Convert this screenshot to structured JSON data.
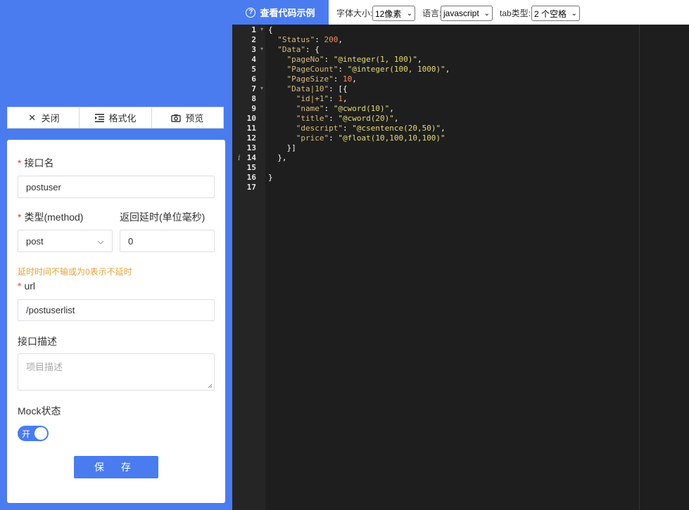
{
  "toolbar": {
    "close": "关闭",
    "format": "格式化",
    "preview": "预览"
  },
  "form": {
    "name_label": "接口名",
    "name_value": "postuser",
    "method_label": "类型(method)",
    "method_value": "post",
    "delay_label": "返回延时(单位毫秒)",
    "delay_value": "0",
    "delay_hint": "延时时间不输或为0表示不延时",
    "url_label": "url",
    "url_value": "/postuserlist",
    "desc_label": "接口描述",
    "desc_placeholder": "项目描述",
    "mock_label": "Mock状态",
    "mock_on": "开",
    "save": "保 存"
  },
  "topbar": {
    "help": "查看代码示例",
    "font_size_label": "字体大小:",
    "font_size_value": "12像素",
    "lang_label": "语言:",
    "lang_value": "javascript",
    "tab_label": "tab类型:",
    "tab_value": "2 个空格"
  },
  "editor": {
    "line_numbers": [
      "1",
      "2",
      "3",
      "4",
      "5",
      "6",
      "7",
      "8",
      "9",
      "10",
      "11",
      "12",
      "13",
      "14",
      "15",
      "16",
      "17"
    ],
    "code": [
      "{",
      "  \"Status\": 200,",
      "  \"Data\": {",
      "    \"pageNo\": \"@integer(1, 100)\",",
      "    \"PageCount\": \"@integer(100, 1000)\",",
      "    \"PageSize\": 10,",
      "    \"Data|10\": [{",
      "      \"id|+1\": 1,",
      "      \"name\": \"@cword(10)\",",
      "      \"title\": \"@cword(20)\",",
      "      \"descript\": \"@csentence(20,50)\",",
      "      \"price\": \"@float(10,100,10,100)\"",
      "    }]",
      "  },",
      "",
      "}",
      ""
    ]
  }
}
